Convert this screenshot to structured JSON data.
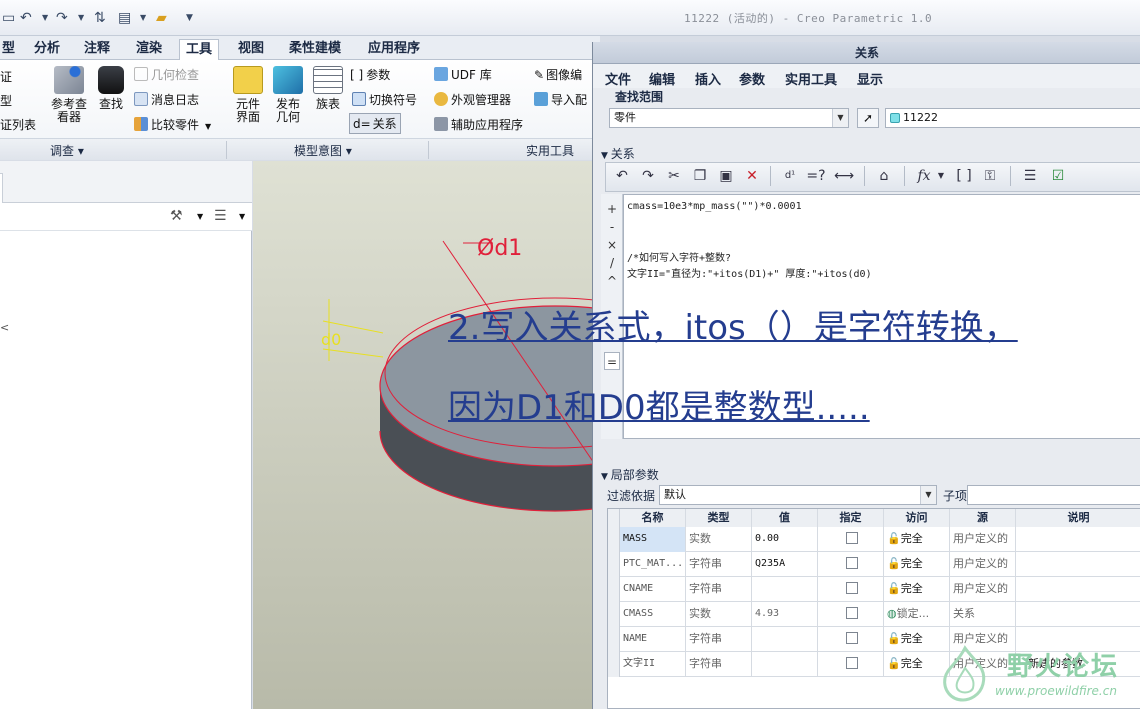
{
  "app": {
    "window_title": "11222 (活动的) - Creo Parametric 1.0"
  },
  "ribbon": {
    "tabs": [
      "型",
      "分析",
      "注释",
      "渲染",
      "工具",
      "视图",
      "柔性建模",
      "应用程序"
    ],
    "active_tab": "工具",
    "left_items": [
      "证",
      "型",
      "证列表"
    ],
    "investigate": {
      "ref_viewer": "参考查看器",
      "find": "查找",
      "geom_check": "几何检查",
      "message_log": "消息日志",
      "compare_part": "比较零件"
    },
    "model_intent": {
      "component_interface": "元件界面",
      "publish_geometry": "发布几何",
      "family_table": "族表",
      "parameters": "参数",
      "switch_symbols": "切换符号",
      "relations": "关系"
    },
    "utilities": {
      "udf_library": "UDF 库",
      "appearance_manager": "外观管理器",
      "aux_app": "辅助应用程序",
      "image_edit": "图像编",
      "import_config": "导入配"
    },
    "groups": [
      "调查",
      "模型意图",
      "实用工具"
    ]
  },
  "graphics": {
    "dim_d1": "Ød1",
    "dim_d0": "d0"
  },
  "dialog": {
    "title": "关系",
    "menu": [
      "文件",
      "编辑",
      "插入",
      "参数",
      "实用工具",
      "显示"
    ],
    "find_scope_label": "查找范围",
    "scope_value": "零件",
    "model_value": "11222",
    "relations_section": "关系",
    "code_lines": [
      "cmass=10e3*mp_mass(\"\")*0.0001",
      "",
      "",
      "/*如何写入字符+整数?",
      "文字II=\"直径为:\"+itos(D1)+\" 厚度:\"+itos(d0)"
    ],
    "local_params_section": "局部参数",
    "filter_label": "过滤依据",
    "filter_value": "默认",
    "subitem_label": "子项",
    "columns": [
      "名称",
      "类型",
      "值",
      "指定",
      "访问",
      "源",
      "说明"
    ],
    "rows": [
      {
        "name": "MASS",
        "type": "实数",
        "value": "0.00",
        "access": "完全",
        "source": "用户定义的",
        "desc": ""
      },
      {
        "name": "PTC_MAT...",
        "type": "字符串",
        "value": "Q235A",
        "access": "完全",
        "source": "用户定义的",
        "desc": ""
      },
      {
        "name": "CNAME",
        "type": "字符串",
        "value": "",
        "access": "完全",
        "source": "用户定义的",
        "desc": ""
      },
      {
        "name": "CMASS",
        "type": "实数",
        "value": "4.93",
        "access": "锁定...",
        "source": "关系",
        "desc": ""
      },
      {
        "name": "NAME",
        "type": "字符串",
        "value": "",
        "access": "完全",
        "source": "用户定义的",
        "desc": ""
      },
      {
        "name": "文字II",
        "type": "字符串",
        "value": "",
        "access": "完全",
        "source": "用户定义的",
        "desc": ""
      }
    ],
    "new_param_caption": "新建的参数"
  },
  "annotation": {
    "line1": "2.写入关系式，itos（）是字符转换，",
    "line2": "因为D1和D0都是整数型....."
  },
  "watermark": {
    "text": "野火论坛",
    "url": "www.proewildfire.cn"
  },
  "colors": {
    "annotation": "#243d8f",
    "model_edge": "#e0203a",
    "dimension": "#e8e020"
  }
}
